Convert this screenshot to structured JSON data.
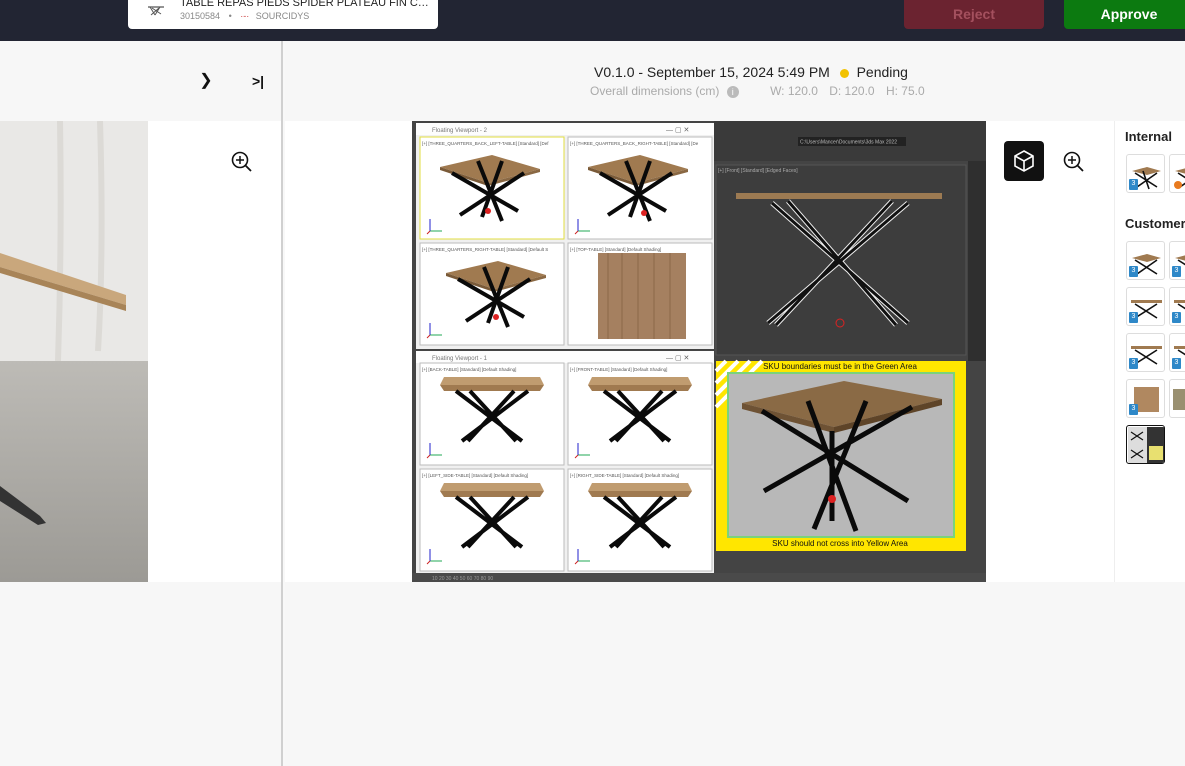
{
  "topbar": {
    "product_name": "TABLE REPAS PIEDS SPIDER PLATEAU FIN CAR...",
    "product_id": "30150584",
    "separator": "•",
    "brand": "SOURCIDYS",
    "reject_label": "Reject",
    "approve_label": "Approve",
    "colors": {
      "bar": "#222533",
      "reject": "#6b2330",
      "approve": "#0c7a10"
    }
  },
  "left_panel": {
    "next_icon": "chevron-right-icon",
    "last_icon": "skip-to-end-icon",
    "zoom_icon": "zoom-in-icon"
  },
  "header": {
    "version_label": "V0.1.0 - September 15, 2024 5:49 PM",
    "status": "Pending",
    "status_color": "#f2c200",
    "dimensions_label": "Overall dimensions (cm)",
    "width": "W: 120.0",
    "depth": "D: 120.0",
    "height": "H: 75.0"
  },
  "viewer": {
    "render": {
      "viewport_top_title": "Floating Viewport - 2",
      "viewport_bottom_title": "Floating Viewport - 1",
      "path_text": "C:\\Users\\Mancer\\Documents\\3ds Max 2022",
      "top_labels": [
        "[+] [THREE_QUARTERS_BACK_LEFT-TABLE] [Standard] [Def",
        "[+] [THREE_QUARTERS_BACK_RIGHT-TABLE] [Standard] [De",
        "[+] [THREE_QUARTERS_RIGHT-TABLE] [Standard] [Default S",
        "[+] [TOP-TABLE] [Standard] [Default Shading]"
      ],
      "bottom_labels": [
        "[+] [BACK-TABLE] [Standard] [Default Shading]",
        "[+] [FRONT-TABLE] [Standard] [Default Shading]",
        "[+] [LEFT_SIDE-TABLE] [Standard] [Default Shading]",
        "[+] [RIGHT_SIDE-TABLE] [Standard] [Default Shading]"
      ],
      "front_label": "[+] [Front] [Standard] [Edged Faces]",
      "green_text": "SKU boundaries must be in the Green Area",
      "yellow_text": "SKU should not cross into Yellow Area"
    },
    "btn_3d_icon": "cube-icon",
    "zoom_icon": "zoom-in-icon"
  },
  "side": {
    "internal_label": "Internal",
    "customer_label": "Customer"
  }
}
